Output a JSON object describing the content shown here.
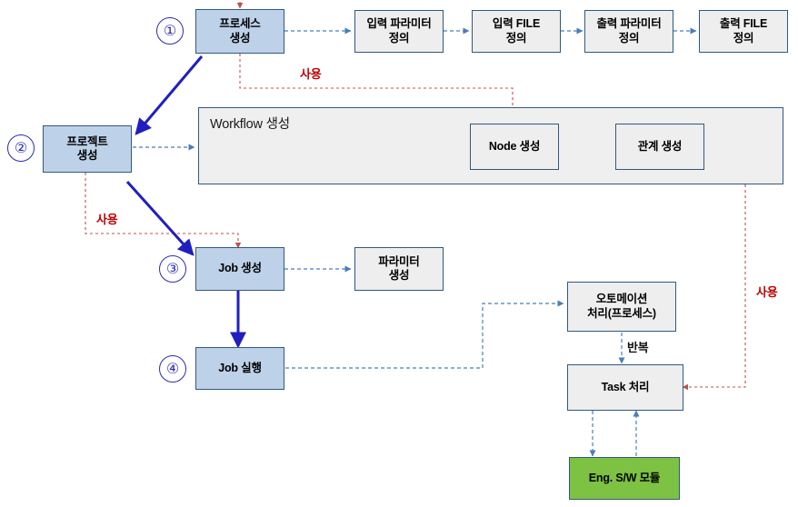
{
  "diagram": {
    "title": "Workflow / Job execution process flow",
    "colors": {
      "box_fill_blue": "#bdd1e9",
      "box_fill_gray": "#eeeeee",
      "box_fill_green": "#7dc242",
      "box_border": "#31597d",
      "container_fill": "#efefef",
      "arrow_blue": "#4a7ebb",
      "arrow_navy": "#1f1fc0",
      "arrow_red": "#c0504d",
      "label_red": "#c00000",
      "circle_number": "#2b2bb5"
    },
    "steps": [
      {
        "number": "①",
        "label": "프로세스\n생성"
      },
      {
        "number": "②",
        "label": "프로젝트\n생성"
      },
      {
        "number": "③",
        "label": "Job 생성"
      },
      {
        "number": "④",
        "label": "Job 실행"
      }
    ],
    "nodes": {
      "process_create_l1": "프로세스",
      "process_create_l2": "생성",
      "input_param_l1": "입력 파라미터",
      "input_param_l2": "정의",
      "input_file_l1": "입력 FILE",
      "input_file_l2": "정의",
      "output_param_l1": "출력 파라미터",
      "output_param_l2": "정의",
      "output_file_l1": "출력 FILE",
      "output_file_l2": "정의",
      "project_create_l1": "프로젝트",
      "project_create_l2": "생성",
      "workflow_container_title": "Workflow 생성",
      "node_create": "Node 생성",
      "relation_create": "관계 생성",
      "job_create": "Job 생성",
      "param_create_l1": "파라미터",
      "param_create_l2": "생성",
      "job_run": "Job 실행",
      "automation_l1": "오토메이션",
      "automation_l2": "처리(프로세스)",
      "task_process": "Task 처리",
      "eng_sw_module": "Eng. S/W 모듈"
    },
    "numbers": {
      "one": "①",
      "two": "②",
      "three": "③",
      "four": "④"
    },
    "edge_labels": {
      "use_top": "사용",
      "use_left": "사용",
      "use_right": "사용",
      "repeat": "반복"
    }
  }
}
